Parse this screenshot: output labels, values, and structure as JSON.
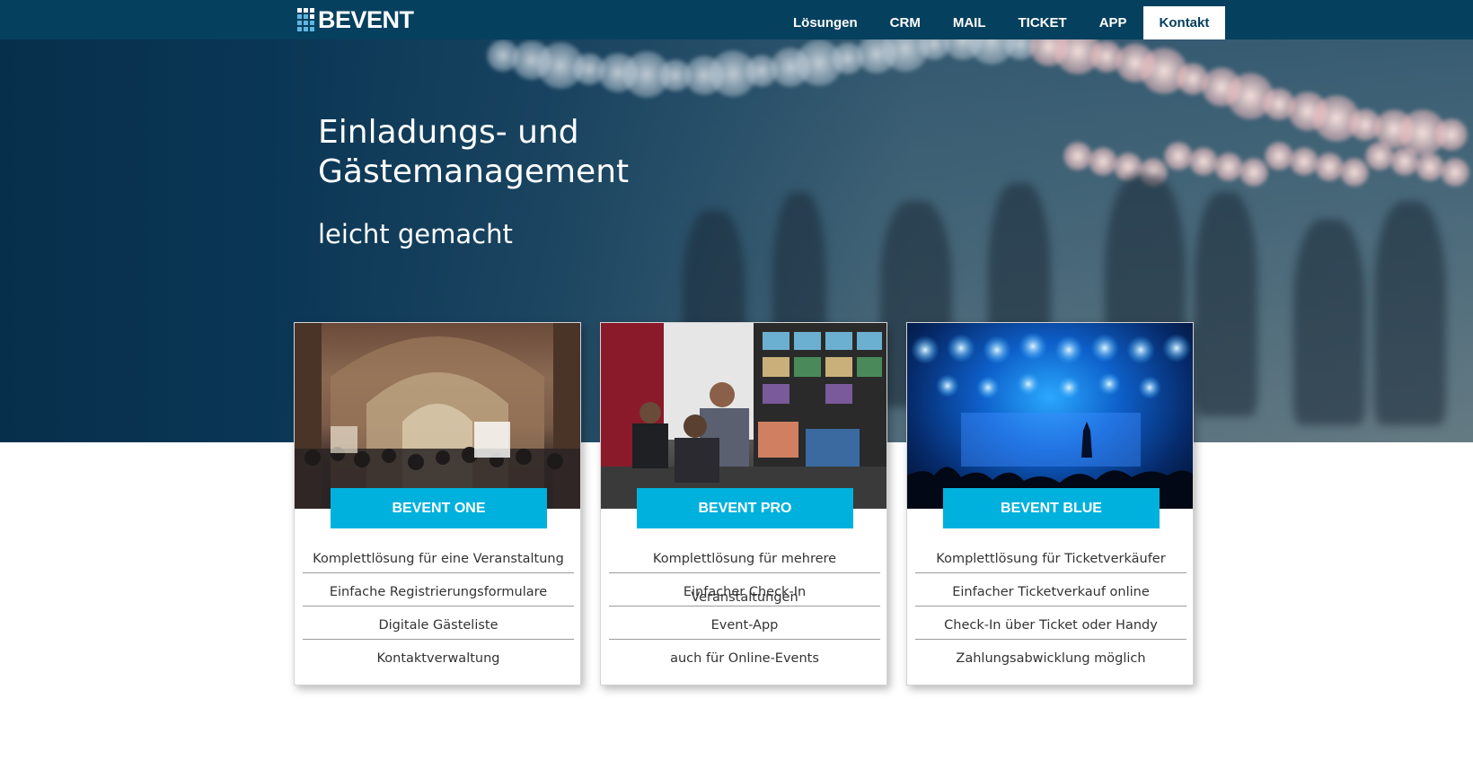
{
  "brand": {
    "name": "BEVENT"
  },
  "nav": {
    "items": [
      {
        "label": "Lösungen"
      },
      {
        "label": "CRM"
      },
      {
        "label": "MAIL"
      },
      {
        "label": "TICKET"
      },
      {
        "label": "APP"
      },
      {
        "label": "Kontakt",
        "active": true
      }
    ]
  },
  "hero": {
    "title": "Einladungs- und\nGästemanagement",
    "subtitle": "leicht gemacht"
  },
  "cards": [
    {
      "button": "BEVENT ONE",
      "image": "event-hall-photo",
      "features": [
        "Komplettlösung für eine Veranstaltung",
        "Einfache Registrierungsformulare",
        "Digitale Gästeliste",
        "Kontaktverwaltung"
      ]
    },
    {
      "button": "BEVENT PRO",
      "image": "control-room-photo",
      "features": [
        "Komplettlösung für mehrere Veranstaltungen",
        "Einfacher Check-In",
        "Event-App",
        "auch für Online-Events"
      ]
    },
    {
      "button": "BEVENT BLUE",
      "image": "concert-stage-photo",
      "features": [
        "Komplettlösung für Ticketverkäufer",
        "Einfacher Ticketverkauf online",
        "Check-In über Ticket oder Handy",
        "Zahlungsabwicklung möglich"
      ]
    }
  ],
  "colors": {
    "header": "#05405f",
    "accent": "#00b1dd",
    "text": "#333333"
  }
}
